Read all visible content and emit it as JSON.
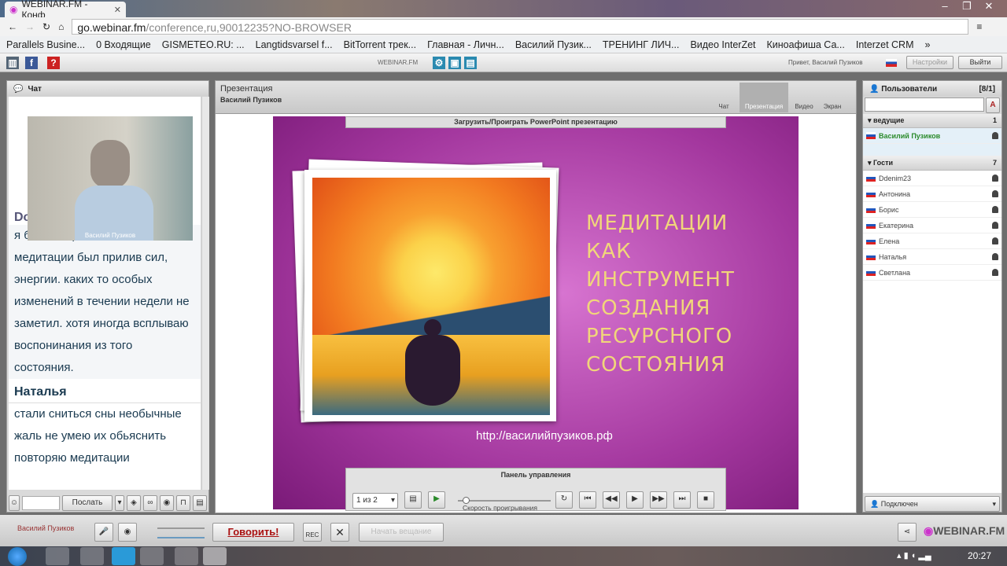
{
  "browser": {
    "tab_title": "WEBINAR.FM - Конф",
    "url_host": "go.webinar.fm",
    "url_path": "/conference,ru,90012235?NO-BROWSER",
    "bookmarks": [
      "Parallels Busine...",
      "0 Входящие",
      "GISMETEO.RU: ...",
      "Langtidsvarsel f...",
      "BitTorrent трек...",
      "Главная - Личн...",
      "Василий Пузик...",
      "ТРЕНИНГ ЛИЧ...",
      "Видео InterZet",
      "Киноафиша Са...",
      "Interzet CRM"
    ]
  },
  "app": {
    "brand": "WEBINAR.FM",
    "greeting": "Привет, Василий Пузиков",
    "settings": "Настройки",
    "logout": "Выйти"
  },
  "chat": {
    "title": "Чат",
    "video_name": "Василий Пузиков",
    "partial_name": "Do",
    "messages": [
      {
        "text": "я был на прошлом, после медитации был прилив сил, энергии. каких то особых изменений в течении недели не заметил. хотя иногда всплываю воспонинания из того состояния."
      },
      {
        "name": "Наталья",
        "text": "стали сниться сны необычные жаль не умею их обьяснить повторяю медитации"
      }
    ],
    "send": "Послать"
  },
  "presentation": {
    "title": "Презентация",
    "presenter": "Василий Пузиков",
    "modes": [
      "Чат",
      "Презентация",
      "Видео",
      "Экран"
    ],
    "upload_bar": "Загрузить/Проиграть PowerPoint презентацию",
    "slide_title": [
      "МЕДИТАЦИИ",
      "КАК",
      "ИНСТРУМЕНТ",
      "СОЗДАНИЯ",
      "РЕСУРСНОГО",
      "СОСТОЯНИЯ"
    ],
    "slide_url": "http://василийпузиков.рф",
    "control_title": "Панель управления",
    "page_select": "1 из 2",
    "speed_label": "Скорость проигрывания",
    "speed": 0.05
  },
  "users": {
    "title": "Пользователи",
    "count": "[8/1]",
    "host_group": "ведущие",
    "host_count": "1",
    "host": "Василий Пузиков",
    "guest_group": "Гости",
    "guest_count": "7",
    "guests": [
      "Ddenim23",
      "Антонина",
      "Борис",
      "Екатерина",
      "Елена",
      "Наталья",
      "Светлана"
    ],
    "status": "Подключен"
  },
  "bottom": {
    "user": "Василий Пузиков",
    "speak": "Говорить!",
    "rec": "REC",
    "share_disabled": "Начать вещание",
    "logo": "WEBINAR.FM"
  },
  "taskbar": {
    "time": "20:27"
  }
}
